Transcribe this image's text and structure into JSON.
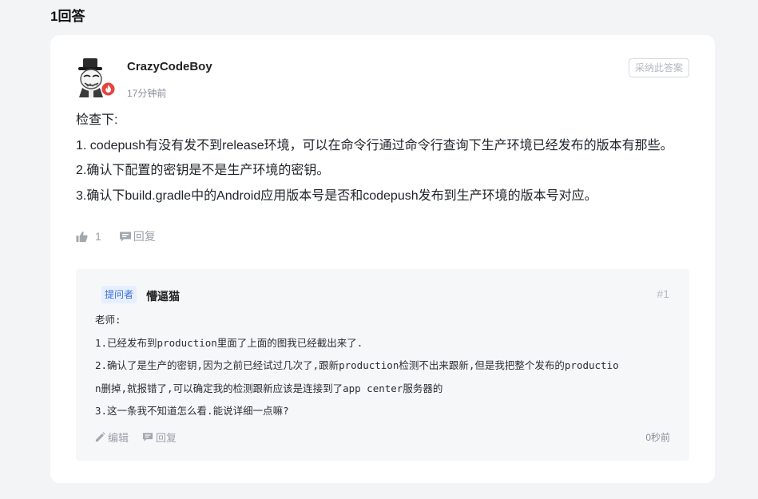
{
  "answers_heading": "1回答",
  "answer": {
    "author": "CrazyCodeBoy",
    "time": "17分钟前",
    "accept_label": "采纳此答案",
    "body": [
      "检查下:",
      "1. codepush有没有发不到release环境，可以在命令行通过命令行查询下生产环境已经发布的版本有那些。",
      "2.确认下配置的密钥是不是生产环境的密钥。",
      "3.确认下build.gradle中的Android应用版本号是否和codepush发布到生产环境的版本号对应。"
    ],
    "like_count": "1",
    "reply_label": "回复"
  },
  "comment": {
    "badge": "提问者",
    "author": "懵逼猫",
    "index": "#1",
    "lines": [
      "老师:",
      "1.已经发布到production里面了上面的图我已经截出来了.",
      "2.确认了是生产的密钥,因为之前已经试过几次了,跟新production检测不出来跟新,但是我把整个发布的productio",
      "n删掉,就报错了,可以确定我的检测跟新应该是连接到了app center服务器的",
      "3.这一条我不知道怎么看.能说详细一点嘛?"
    ],
    "edit_label": "编辑",
    "reply_label": "回复",
    "time": "0秒前"
  },
  "icons": {
    "avatar": "meme-avatar-with-top-hat",
    "badge": "flame-badge-icon",
    "like": "thumbs-up-icon",
    "reply": "comment-bubble-icon",
    "edit": "pencil-icon"
  },
  "colors": {
    "page_background": "#f3f4f6",
    "card_background": "#ffffff",
    "comment_background": "#f6f7f9",
    "badge_background": "#e6efff",
    "badge_text": "#3a6fd6",
    "muted_text": "#9aa0a8"
  }
}
